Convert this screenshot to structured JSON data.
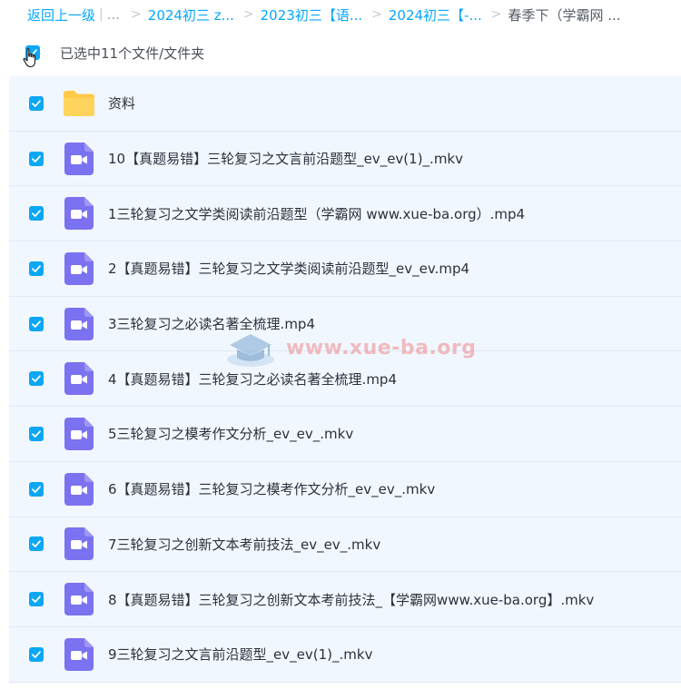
{
  "breadcrumb": {
    "back_label": "返回上一级",
    "separator_bar": "|",
    "ellipsis": "...",
    "separator": ">",
    "items": [
      {
        "label": "2024初三 z..."
      },
      {
        "label": "2023初三【语..."
      },
      {
        "label": "2024初三【-..."
      }
    ],
    "current": "春季下（学霸网 ..."
  },
  "selection": {
    "label": "已选中11个文件/文件夹"
  },
  "files": [
    {
      "name": "资料",
      "type": "folder",
      "checked": true,
      "icon": "folder-icon"
    },
    {
      "name": "10【真题易错】三轮复习之文言前沿题型_ev_ev(1)_.mkv",
      "type": "video",
      "checked": true,
      "icon": "video-file-icon"
    },
    {
      "name": "1三轮复习之文学类阅读前沿题型（学霸网 www.xue-ba.org）.mp4",
      "type": "video",
      "checked": true,
      "icon": "video-file-icon"
    },
    {
      "name": "2【真题易错】三轮复习之文学类阅读前沿题型_ev_ev.mp4",
      "type": "video",
      "checked": true,
      "icon": "video-file-icon"
    },
    {
      "name": "3三轮复习之必读名著全梳理.mp4",
      "type": "video",
      "checked": true,
      "icon": "video-file-icon"
    },
    {
      "name": "4【真题易错】三轮复习之必读名著全梳理.mp4",
      "type": "video",
      "checked": true,
      "icon": "video-file-icon"
    },
    {
      "name": "5三轮复习之模考作文分析_ev_ev_.mkv",
      "type": "video",
      "checked": true,
      "icon": "video-file-icon"
    },
    {
      "name": "6【真题易错】三轮复习之模考作文分析_ev_ev_.mkv",
      "type": "video",
      "checked": true,
      "icon": "video-file-icon"
    },
    {
      "name": "7三轮复习之创新文本考前技法_ev_ev_.mkv",
      "type": "video",
      "checked": true,
      "icon": "video-file-icon"
    },
    {
      "name": "8【真题易错】三轮复习之创新文本考前技法_【学霸网www.xue-ba.org】.mkv",
      "type": "video",
      "checked": true,
      "icon": "video-file-icon"
    },
    {
      "name": "9三轮复习之文言前沿题型_ev_ev(1)_.mkv",
      "type": "video",
      "checked": true,
      "icon": "video-file-icon"
    }
  ],
  "watermark": {
    "text": "www.xue-ba.org"
  },
  "colors": {
    "accent": "#06a7ff",
    "checkbox": "#0ba7f5",
    "row_selected_bg": "#f1f7ff",
    "video_icon": "#7a72f0",
    "folder_icon": "#ffc94a"
  }
}
